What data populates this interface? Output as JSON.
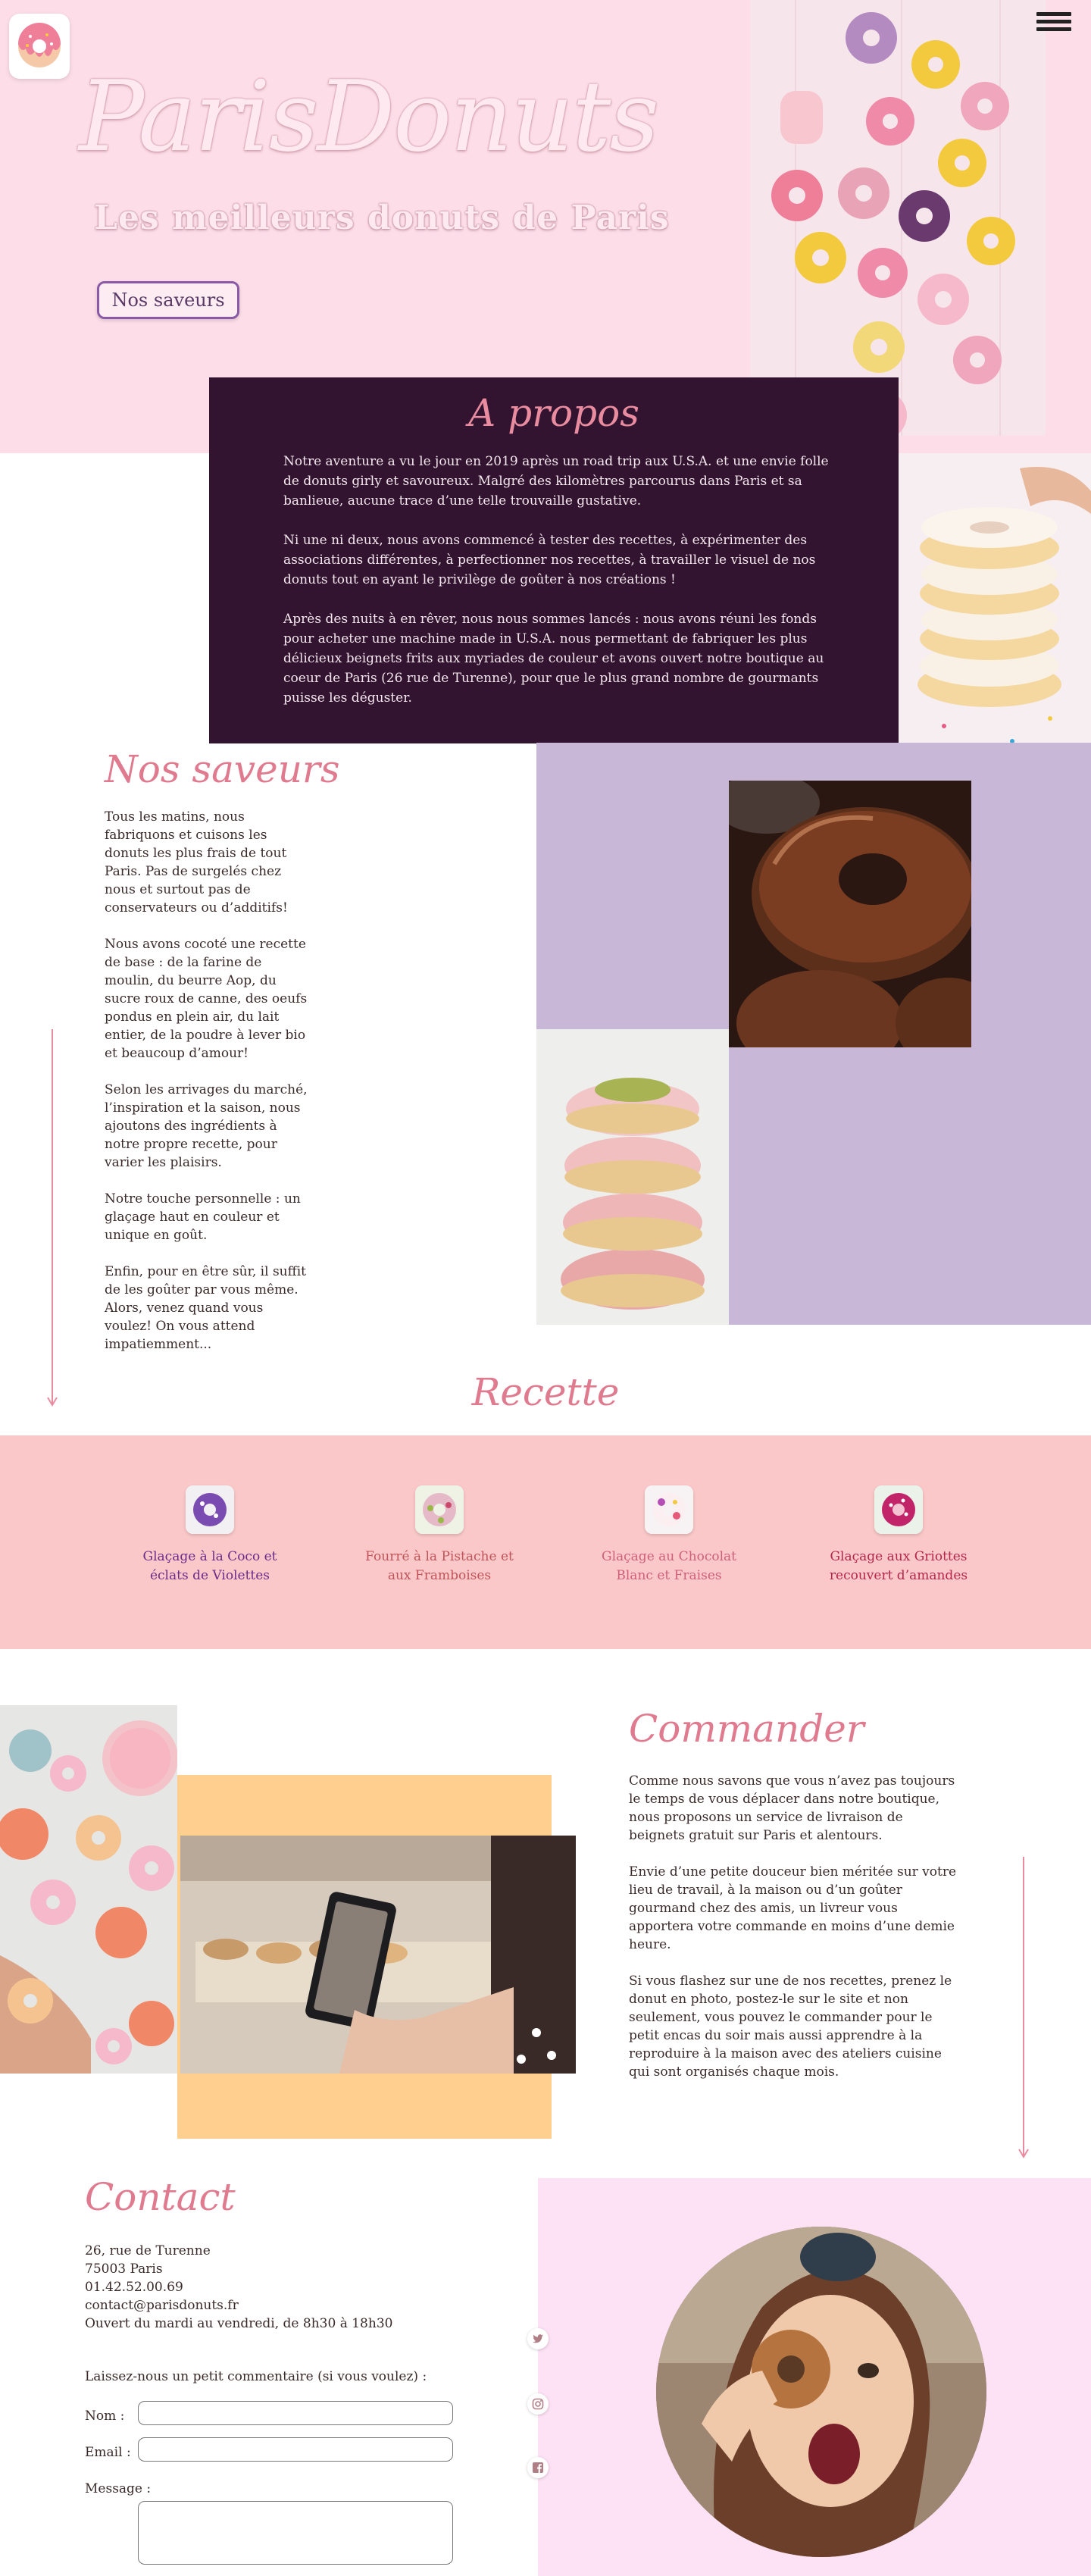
{
  "header": {
    "brand": "ParisDonuts",
    "tagline": "Les meilleurs donuts de Paris",
    "cta_label": "Nos saveurs",
    "logo_icon": "donut-logo-icon",
    "menu_icon": "hamburger-menu-icon"
  },
  "about": {
    "title": "A propos",
    "paragraphs": [
      "Notre aventure a vu le jour en 2019 après un road trip aux U.S.A. et une envie folle de donuts girly et savoureux. Malgré des kilomètres parcourus dans Paris et sa banlieue, aucune trace d’une telle trouvaille gustative.",
      "Ni une ni deux, nous avons commencé à tester des recettes, à expérimenter des associations différentes, à perfectionner nos recettes, à travailler le visuel de nos donuts tout en ayant le privilège de goûter à nos créations !",
      "Après des nuits à en rêver, nous nous sommes lancés : nous avons réuni les fonds pour acheter une machine made in U.S.A. nous permettant de fabriquer les plus délicieux beignets frits aux myriades de couleur  et avons ouvert notre boutique au coeur de Paris (26 rue de Turenne), pour que le plus grand nombre de gourmants puisse les déguster."
    ]
  },
  "saveurs": {
    "title": "Nos saveurs",
    "paragraphs": [
      "Tous les matins, nous fabriquons et cuisons les donuts les plus frais de tout Paris. Pas de surgelés chez nous et surtout pas de conservateurs ou d’additifs!",
      "Nous avons cocoté une recette de base : de la farine de moulin, du beurre Aop, du sucre roux de canne, des oeufs pondus en plein air, du lait entier, de la poudre à lever bio et beaucoup d’amour!",
      "Selon les arrivages du marché, l’inspiration et la saison, nous ajoutons des ingrédients à notre propre recette, pour varier les plaisirs.",
      "Notre touche personnelle : un glaçage haut en couleur et unique en goût.",
      "Enfin, pour en être sûr, il suffit de les goûter par vous même. Alors, venez quand vous voulez!  On vous attend impatiemment..."
    ]
  },
  "recette": {
    "title": "Recette",
    "items": [
      {
        "line1": "Glaçage à la Coco et",
        "line2": "éclats de Violettes",
        "color": "#6a2c8a",
        "icon": "violet-donut-icon"
      },
      {
        "line1": "Fourré à la Pistache et",
        "line2": "aux Framboises",
        "color": "#c0545a",
        "icon": "pistachio-donut-icon"
      },
      {
        "line1": "Glaçage au Chocolat",
        "line2": "Blanc et Fraises",
        "color": "#d0607a",
        "icon": "strawberry-donut-icon"
      },
      {
        "line1": "Glaçage aux Griottes",
        "line2": "recouvert d’amandes",
        "color": "#b5264a",
        "icon": "cherry-donut-icon"
      }
    ]
  },
  "commander": {
    "title": "Commander",
    "paragraphs": [
      "Comme nous savons que vous n’avez pas toujours le temps de vous déplacer dans notre boutique, nous proposons un service de livraison de beignets gratuit sur Paris et alentours.",
      "Envie d’une petite douceur bien méritée sur votre lieu de travail, à la maison ou d’un goûter gourmand chez des amis, un livreur vous apportera votre commande en moins d’une demie heure.",
      "Si vous flashez sur une de nos recettes, prenez le donut en photo, postez-le sur le site et non seulement, vous pouvez le commander pour le petit encas du soir mais aussi apprendre à la reproduire à la maison avec des ateliers cuisine qui sont organisés chaque mois."
    ]
  },
  "contact": {
    "title": "Contact",
    "address1": "26, rue de Turenne",
    "address2": "75003 Paris",
    "phone": "01.42.52.00.69",
    "email": "contact@parisdonuts.fr",
    "hours": "Ouvert du mardi au vendredi, de 8h30 à 18h30",
    "form_prompt": "Laissez-nous un petit commentaire (si vous voulez) :",
    "name_label": "Nom :",
    "email_label": "Email :",
    "message_label": "Message :",
    "name_value": "",
    "email_value": "",
    "message_value": ""
  },
  "social": [
    "twitter-icon",
    "instagram-icon",
    "facebook-icon"
  ],
  "colors": {
    "hero_bg": "#fcdde8",
    "about_bg": "#331430",
    "accent_pink": "#e07a8f",
    "lavender": "#c9b7d8",
    "recette_bg": "#fac8c8",
    "peach": "#fecf8f",
    "contact_bg": "#fde1f4",
    "button_border": "#8b5aa6"
  }
}
